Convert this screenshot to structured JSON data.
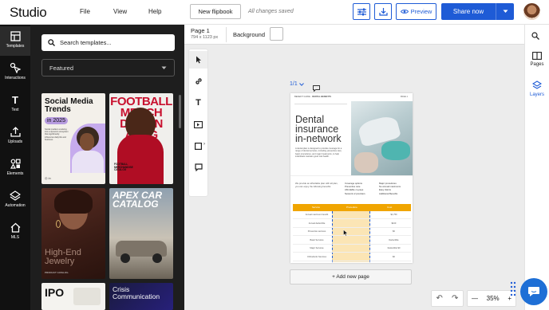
{
  "header": {
    "logo": "Studio",
    "menu": [
      "File",
      "View",
      "Help"
    ],
    "doc_button": "New flipbook",
    "save_status": "All changes saved",
    "preview_label": "Preview",
    "share_label": "Share now"
  },
  "left_rail": [
    {
      "label": "Templates",
      "icon": "templates-icon"
    },
    {
      "label": "Interactions",
      "icon": "interactions-icon"
    },
    {
      "label": "Text",
      "icon": "text-icon"
    },
    {
      "label": "Uploads",
      "icon": "upload-icon"
    },
    {
      "label": "Elements",
      "icon": "elements-icon"
    },
    {
      "label": "Automation",
      "icon": "automation-icon"
    },
    {
      "label": "MLS",
      "icon": "house-icon"
    }
  ],
  "templates_panel": {
    "search_placeholder": "Search templates...",
    "filter_value": "Featured",
    "cards": [
      {
        "title": "Social Media Trends",
        "subtitle": "in 2025",
        "caption": "Social media is evolving into a dynamic ecosystem that significantly influences daily life and business"
      },
      {
        "title": "FOOTBALL MERCHANDISE CATALOG",
        "big": "FOOTBALL MERCHANDISE CATALOG",
        "caption": "FOOTBALL MERCHANDISE CATALOG"
      },
      {
        "title": "High-End Jewelry",
        "caption": "PRODUCT CATALOG"
      },
      {
        "title": "APEX CAR CATALOG"
      },
      {
        "title": "IPO"
      },
      {
        "title": "Crisis Communication"
      }
    ]
  },
  "page_toolbar": {
    "page_label": "Page 1",
    "page_size": "794 x 1123 px",
    "background_label": "Background"
  },
  "page_nav": {
    "indicator": "1/1"
  },
  "page_content": {
    "header_left": "BENEFIT GUIDE",
    "header_mid": "DENTAL BENEFITS",
    "header_right": "PAGE 1",
    "title_line1": "Dental",
    "title_line2": "insurance",
    "title_line3": "in-network",
    "body": "A dental plan is designed to provide coverage for a range of dental services, including preventive care, basic procedures, and major treatments, to help individuals maintain good oral health.",
    "intro": "We provide an affordable plan with all plan, you can enjoy the following benefits:",
    "bullets_left": [
      "Coverage options",
      "Preventive care",
      "Affordable co-pays",
      "Network of providers"
    ],
    "bullets_right": [
      "Major procedures",
      "No annual maximums",
      "Easy claims",
      "Additional Benefits"
    ],
    "table_headers": [
      "Service",
      "Procedure",
      "Cost"
    ],
    "table_rows": [
      [
        "Annual maximum benefit",
        "",
        "$1,750"
      ],
      [
        "Annual deductible",
        "",
        "$100"
      ],
      [
        "Preventive services",
        "",
        "$0"
      ],
      [
        "Basic Services",
        "",
        "Deductible"
      ],
      [
        "Major Services",
        "",
        "Deductible $0"
      ],
      [
        "Orthodontic Services",
        "",
        "$0"
      ]
    ]
  },
  "add_page_label": "+ Add new page",
  "right_rail": [
    {
      "label": "Pages",
      "icon": "pages-icon"
    },
    {
      "label": "Layers",
      "icon": "layers-icon"
    }
  ],
  "zoom": {
    "level": "35%"
  },
  "colors": {
    "accent": "#1e5bd6",
    "panel": "#1e1e1e",
    "rail": "#111111",
    "canvas": "#ececec",
    "table_header": "#f0a500",
    "highlight": "#fbe5b5"
  }
}
